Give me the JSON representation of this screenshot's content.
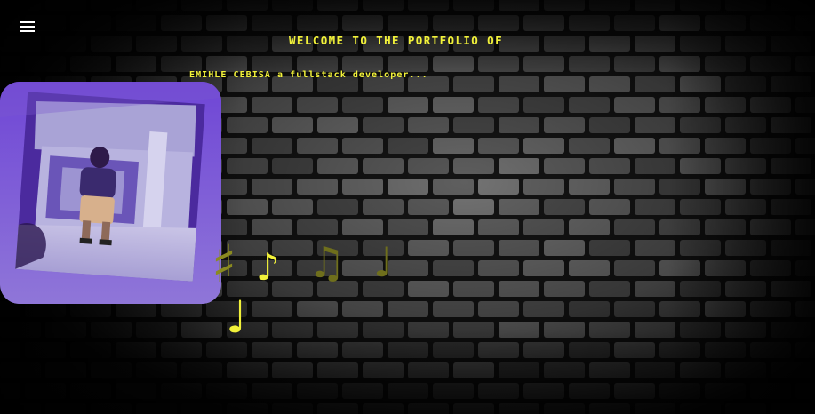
{
  "header": {
    "menu_icon": "hamburger-menu-icon",
    "title": "WELCOME TO THE PORTFOLIO OF",
    "subtitle": "EMIHLE CEBISA a fullstack developer..."
  },
  "profile": {
    "photo_icon": "profile-photo"
  },
  "music_notes": {
    "sharp": "♯",
    "eighth": "♪",
    "beamed": "♫",
    "quarter": "♩",
    "quarter_low": "♩"
  },
  "colors": {
    "accent": "#f2f23a",
    "note_dim": "#8a8a20",
    "card_purple": "#6a45c2",
    "background": "#1a1a1a"
  }
}
